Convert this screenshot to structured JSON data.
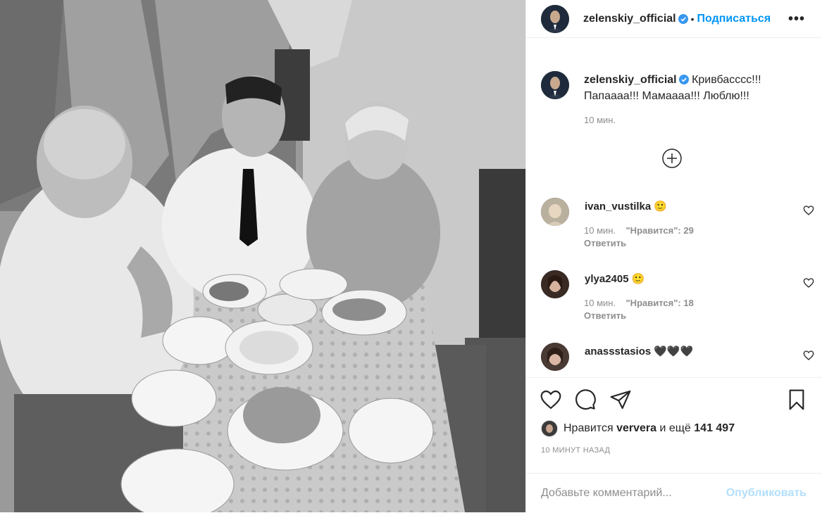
{
  "post": {
    "username": "zelenskiy_official",
    "follow_label": "Подписаться",
    "dot": "•",
    "more_label": "•••",
    "caption_text": "Кривбасссс!!! Папаааа!!! Мамаааа!!! Люблю!!!",
    "caption_time": "10 мин.",
    "load_more_icon": "plus-circle-icon"
  },
  "comments": [
    {
      "user": "ivan_vustilka",
      "emoji": "🙂",
      "time": "10 мин.",
      "likes_label": "\"Нравится\": 29",
      "reply": "Ответить"
    },
    {
      "user": "ylya2405",
      "emoji": "🙂",
      "time": "10 мин.",
      "likes_label": "\"Нравится\": 18",
      "reply": "Ответить"
    },
    {
      "user": "anassstasios",
      "emoji": "🖤🖤🖤",
      "time": "",
      "likes_label": "",
      "reply": ""
    }
  ],
  "actions": {
    "like_icon": "heart-icon",
    "comment_icon": "comment-icon",
    "share_icon": "send-icon",
    "save_icon": "bookmark-icon"
  },
  "likes": {
    "prefix": "Нравится",
    "liker": "ververa",
    "and_more": "и ещё",
    "count": "141 497"
  },
  "timestamp": "10 минут назад",
  "add_comment": {
    "placeholder": "Добавьте комментарий...",
    "publish_label": "Опубликовать"
  },
  "colors": {
    "accent": "#0095f6",
    "publish_disabled": "#b2dffc",
    "muted": "#8e8e8e",
    "text": "#262626"
  }
}
